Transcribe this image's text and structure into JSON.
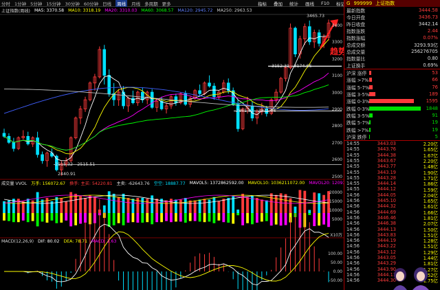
{
  "timeframes": [
    "分时",
    "1分钟",
    "5分钟",
    "15分钟",
    "30分钟",
    "60分钟",
    "日线",
    "周线",
    "月线",
    "多周期",
    "更多"
  ],
  "active_timeframe_index": 7,
  "toolbar": [
    "指标",
    "叠加",
    "统计",
    "画线",
    "F10",
    "标记"
  ],
  "ma_bar": {
    "title": "上证指数(周线)",
    "ma5": "MA5: 3370.58",
    "ma10": "MA10: 3318.19",
    "ma20": "MA20: 3310.03",
    "ma60": "MA60: 3068.57",
    "ma120": "MA120: 2945.72",
    "ma250": "MA250: 2963.53"
  },
  "price_labels": {
    "high": "3465.73",
    "mark1": "3152.31 - 3174.66",
    "mark2": "2861.92 - 2871.96",
    "mark3": "2515.32 - 2515.51",
    "low": "2440.91"
  },
  "annotation": "趋势向上",
  "vol_bar": {
    "title": "成交量 VVOL",
    "v1": "万手: 156072.67",
    "v2": "换手: 主买: 54220.81",
    "v3": "主卖: -62643.76",
    "v4": "空空: 18887.77",
    "mavol5": "MAVOL5: 1372862592.00",
    "mavol10": "MAVOL10: 1036211072.00",
    "mavol20": "MAVOL20: 12093975"
  },
  "macd_bar": {
    "title": "MACD(12,26,9)",
    "dif": "DIF: 80.02",
    "dea": "DEA: 78.71",
    "macd": "MACD: 2.63"
  },
  "axis_price": [
    "3400",
    "3300",
    "3200",
    "3100",
    "3000",
    "2900",
    "2800",
    "2700",
    "2600",
    "2500"
  ],
  "axis_vol": [
    "20000",
    "15000",
    "10000",
    "5000"
  ],
  "axis_vol_unit": "X10万",
  "axis_macd": [
    "100.00",
    "50.00",
    "0.00",
    "-50.00"
  ],
  "axis_macd_tag": "0.00",
  "colors": {
    "up": "#ff3b3b",
    "down": "#00e0ff",
    "ma5": "#ffffff",
    "ma10": "#ffff00",
    "ma20": "#ff00ff",
    "ma60": "#00ff00",
    "ma120": "#4060ff",
    "ma250": "#c0c0c0"
  },
  "chart_data": {
    "type": "line",
    "title": "上证指数(周线)",
    "ylim": [
      2440,
      3500
    ],
    "candles": [
      [
        2720,
        2750,
        2690,
        2700
      ],
      [
        2700,
        2720,
        2650,
        2660
      ],
      [
        2660,
        2690,
        2600,
        2620
      ],
      [
        2620,
        2700,
        2610,
        2690
      ],
      [
        2690,
        2740,
        2680,
        2700
      ],
      [
        2700,
        2730,
        2640,
        2650
      ],
      [
        2650,
        2700,
        2630,
        2690
      ],
      [
        2690,
        2730,
        2560,
        2580
      ],
      [
        2580,
        2600,
        2520,
        2540
      ],
      [
        2540,
        2600,
        2500,
        2590
      ],
      [
        2590,
        2620,
        2560,
        2570
      ],
      [
        2570,
        2580,
        2470,
        2480
      ],
      [
        2480,
        2540,
        2441,
        2520
      ],
      [
        2520,
        2560,
        2500,
        2540
      ],
      [
        2540,
        2700,
        2530,
        2690
      ],
      [
        2690,
        2830,
        2680,
        2820
      ],
      [
        2820,
        2900,
        2780,
        2880
      ],
      [
        2880,
        2960,
        2860,
        2940
      ],
      [
        2940,
        3060,
        2930,
        3050
      ],
      [
        3050,
        3110,
        3000,
        3090
      ],
      [
        3090,
        3290,
        3080,
        3270
      ],
      [
        3270,
        3300,
        3040,
        3100
      ],
      [
        3100,
        3140,
        2960,
        2980
      ],
      [
        2980,
        3050,
        2900,
        2940
      ],
      [
        2940,
        3010,
        2900,
        2990
      ],
      [
        2990,
        3030,
        2880,
        2900
      ],
      [
        2900,
        2960,
        2860,
        2950
      ],
      [
        2950,
        3000,
        2910,
        2920
      ],
      [
        2920,
        3000,
        2900,
        2990
      ],
      [
        2990,
        3020,
        2920,
        2940
      ],
      [
        2940,
        3000,
        2910,
        2990
      ],
      [
        2990,
        3010,
        2880,
        2890
      ],
      [
        2890,
        2950,
        2860,
        2930
      ],
      [
        2930,
        2960,
        2870,
        2880
      ],
      [
        2880,
        2920,
        2850,
        2900
      ],
      [
        2900,
        2970,
        2880,
        2960
      ],
      [
        2960,
        2980,
        2900,
        2920
      ],
      [
        2920,
        2990,
        2910,
        2980
      ],
      [
        2980,
        3000,
        2900,
        2910
      ],
      [
        2910,
        2960,
        2890,
        2950
      ],
      [
        2950,
        3010,
        2940,
        3000
      ],
      [
        3000,
        3040,
        2960,
        2980
      ],
      [
        2980,
        3060,
        2970,
        3050
      ],
      [
        3050,
        3100,
        3020,
        3030
      ],
      [
        3030,
        3050,
        2940,
        2960
      ],
      [
        2960,
        3000,
        2940,
        2990
      ],
      [
        2990,
        3070,
        2980,
        3050
      ],
      [
        3050,
        3080,
        2980,
        3000
      ],
      [
        3000,
        3020,
        2900,
        2910
      ],
      [
        2910,
        2940,
        2730,
        2750
      ],
      [
        2750,
        2890,
        2740,
        2880
      ],
      [
        2880,
        2960,
        2850,
        2900
      ],
      [
        2900,
        2930,
        2800,
        2820
      ],
      [
        2820,
        2880,
        2780,
        2860
      ],
      [
        2860,
        2920,
        2840,
        2880
      ],
      [
        2880,
        2900,
        2830,
        2850
      ],
      [
        2850,
        2950,
        2840,
        2940
      ],
      [
        2940,
        3010,
        2920,
        2990
      ],
      [
        2990,
        3090,
        2980,
        3080
      ],
      [
        3080,
        3160,
        3060,
        3150
      ],
      [
        3150,
        3440,
        3140,
        3410
      ],
      [
        3410,
        3420,
        3220,
        3240
      ],
      [
        3240,
        3360,
        3210,
        3340
      ],
      [
        3340,
        3440,
        3300,
        3420
      ],
      [
        3420,
        3460,
        3300,
        3320
      ],
      [
        3320,
        3400,
        3280,
        3380
      ],
      [
        3380,
        3400,
        3290,
        3310
      ],
      [
        3310,
        3370,
        3280,
        3350
      ],
      [
        3350,
        3466,
        3330,
        3443
      ]
    ]
  },
  "quote": {
    "g_label": "G",
    "code": "999999",
    "name": "上证指数",
    "rows": [
      {
        "k": "最新指数",
        "v": "3444.58",
        "c": "red"
      },
      {
        "k": "今日开盘",
        "v": "3436.73",
        "c": "red"
      },
      {
        "k": "昨日收盘",
        "v": "3442.14",
        "c": "wht"
      },
      {
        "k": "指数涨跌",
        "v": "2.44",
        "c": "red"
      },
      {
        "k": "指数涨幅",
        "v": "0.07%",
        "c": "red"
      },
      {
        "k": "总成交额",
        "v": "3293.93亿",
        "c": "wht"
      },
      {
        "k": "总成交量",
        "v": "256276705",
        "c": "wht"
      },
      {
        "k": "指数量比",
        "v": "0.80",
        "c": "wht"
      },
      {
        "k": "上证换手",
        "v": "0.69%",
        "c": "wht"
      }
    ],
    "dist": [
      {
        "k": "沪深 涨停",
        "v": "53",
        "c": "red",
        "w": 0.04,
        "col": "#ff3b3b"
      },
      {
        "k": "涨幅 >7%",
        "v": "66",
        "c": "red",
        "w": 0.05,
        "col": "#ff3b3b"
      },
      {
        "k": "涨幅 5-7%",
        "v": "76",
        "c": "red",
        "w": 0.06,
        "col": "#ff3b3b"
      },
      {
        "k": "涨幅 3-5%",
        "v": "189",
        "c": "red",
        "w": 0.12,
        "col": "#ff3b3b"
      },
      {
        "k": "涨幅 0-3%",
        "v": "1595",
        "c": "red",
        "w": 0.86,
        "col": "#ff3b3b"
      },
      {
        "k": "跌幅 0-3%",
        "v": "1848",
        "c": "grn",
        "w": 1.0,
        "col": "#00e000"
      },
      {
        "k": "跌幅 3-5%",
        "v": "91",
        "c": "grn",
        "w": 0.06,
        "col": "#00e000"
      },
      {
        "k": "跌幅 5-7%",
        "v": "19",
        "c": "grn",
        "w": 0.02,
        "col": "#00e000"
      },
      {
        "k": "跌幅 >7%",
        "v": "19",
        "c": "grn",
        "w": 0.02,
        "col": "#00e000"
      },
      {
        "k": "沪深 跌停",
        "v": "5",
        "c": "grn",
        "w": 0.01,
        "col": "#00e000"
      }
    ],
    "ticks": [
      [
        "14:55",
        "3443.03",
        "2.20亿"
      ],
      [
        "14:55",
        "3443.76",
        "1.65亿"
      ],
      [
        "14:55",
        "3444.38",
        "1.67亿"
      ],
      [
        "14:55",
        "3443.67",
        "2.20亿"
      ],
      [
        "14:55",
        "3443.77",
        "1.48亿"
      ],
      [
        "14:55",
        "3443.19",
        "1.90亿"
      ],
      [
        "14:55",
        "3443.28",
        "1.71亿"
      ],
      [
        "14:55",
        "3444.14",
        "1.86亿"
      ],
      [
        "14:55",
        "3444.12",
        "1.59亿"
      ],
      [
        "14:56",
        "3444.05",
        "2.04亿"
      ],
      [
        "14:56",
        "3445.10",
        "1.65亿"
      ],
      [
        "14:56",
        "3444.32",
        "1.61亿"
      ],
      [
        "14:56",
        "3444.69",
        "1.66亿"
      ],
      [
        "14:56",
        "3446.46",
        "1.81亿"
      ],
      [
        "14:56",
        "3446.38",
        "2.07亿"
      ],
      [
        "14:56",
        "3444.13",
        "1.50亿"
      ],
      [
        "14:56",
        "3443.83",
        "1.51亿"
      ],
      [
        "14:56",
        "3444.19",
        "1.28亿"
      ],
      [
        "14:56",
        "3443.22",
        "1.51亿"
      ],
      [
        "14:56",
        "3443.12",
        "1.29亿"
      ],
      [
        "14:56",
        "3443.05",
        "1.44亿"
      ],
      [
        "14:56",
        "3443.29",
        "1.81亿"
      ],
      [
        "14:56",
        "3443.90",
        "1.27亿"
      ],
      [
        "14:56",
        "3444.11",
        "1.52亿"
      ],
      [
        "14:56",
        "3444.30",
        "1.75亿"
      ]
    ]
  }
}
